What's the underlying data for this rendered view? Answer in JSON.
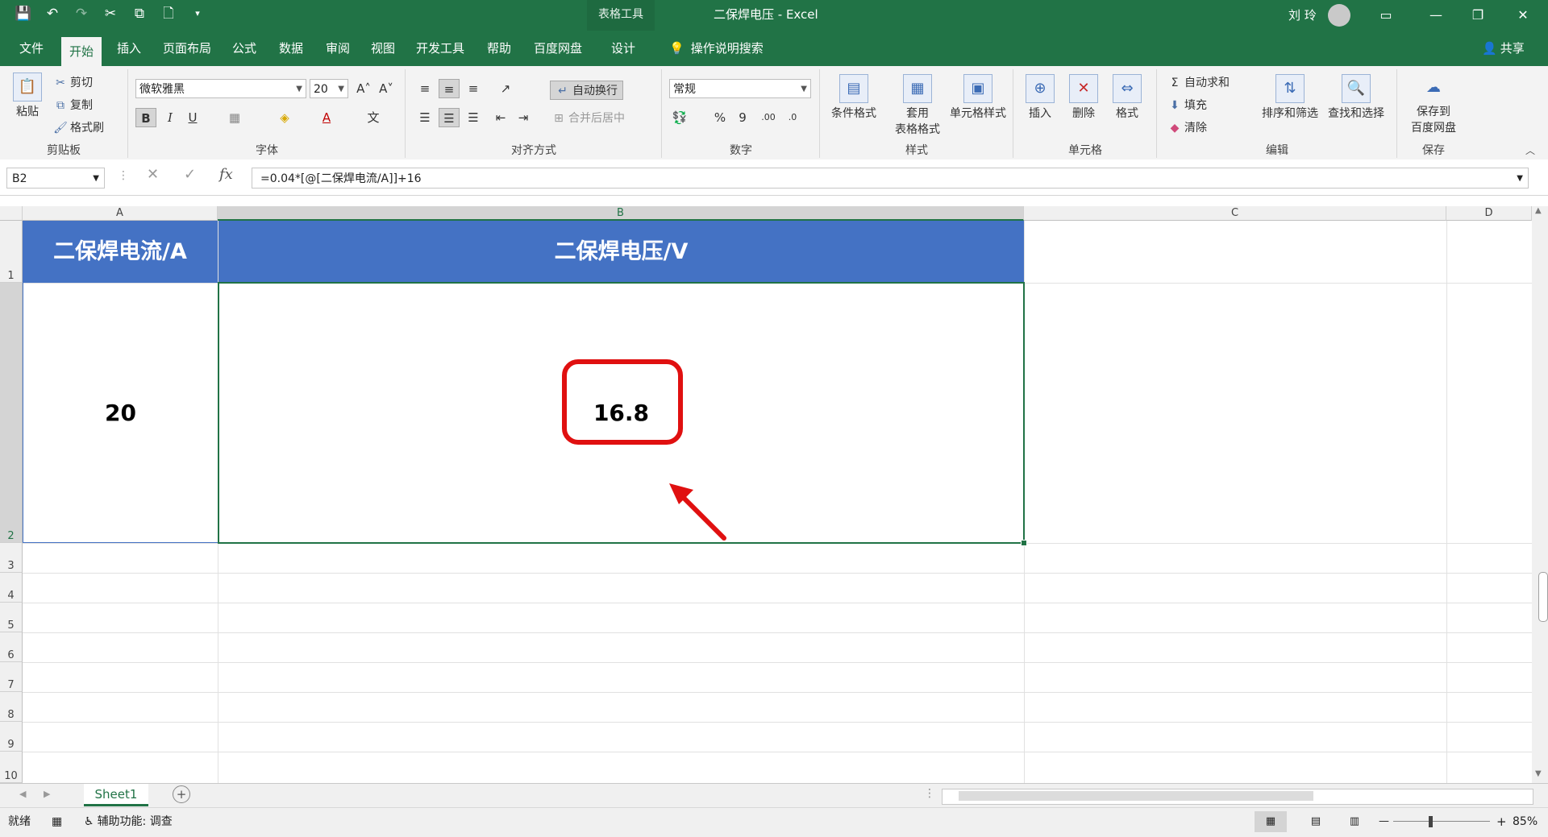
{
  "window": {
    "title": "二保焊电压  -  Excel",
    "context_tab": "表格工具",
    "user": "刘 玲",
    "controls": [
      "▭",
      "—",
      "❐",
      "✕"
    ]
  },
  "qat": [
    "💾",
    "↶",
    "↷",
    "✂",
    "⧉",
    "🗋",
    "▾"
  ],
  "tabs": [
    "文件",
    "开始",
    "插入",
    "页面布局",
    "公式",
    "数据",
    "审阅",
    "视图",
    "开发工具",
    "帮助",
    "百度网盘",
    "设计"
  ],
  "tell_me": "操作说明搜索",
  "share": "共享",
  "ribbon": {
    "clipboard": {
      "label": "剪贴板",
      "paste": "粘贴",
      "cut": "剪切",
      "copy": "复制",
      "format_painter": "格式刷"
    },
    "font": {
      "label": "字体",
      "name": "微软雅黑",
      "size": "20",
      "bold": "B",
      "italic": "I",
      "underline": "U",
      "grow": "A˄",
      "shrink": "A˅",
      "color_a": "A",
      "phonetic": "文"
    },
    "alignment": {
      "label": "对齐方式",
      "wrap": "自动换行",
      "merge": "合并后居中"
    },
    "number": {
      "label": "数字",
      "format": "常规",
      "percent": "%",
      "comma": "9",
      "inc": ".00",
      "dec": ".0"
    },
    "styles": {
      "label": "样式",
      "conditional": "条件格式",
      "table_format_1": "套用",
      "table_format_2": "表格格式",
      "cell_styles": "单元格样式"
    },
    "cells": {
      "label": "单元格",
      "insert": "插入",
      "delete": "删除",
      "format": "格式"
    },
    "editing": {
      "label": "编辑",
      "autosum": "自动求和",
      "fill": "填充",
      "clear": "清除",
      "sort": "排序和筛选",
      "find": "查找和选择"
    },
    "save": {
      "label": "保存",
      "save_to_1": "保存到",
      "save_to_2": "百度网盘"
    }
  },
  "formula_bar": {
    "name_box": "B2",
    "formula": "=0.04*[@[二保焊电流/A]]+16",
    "fx": "fx",
    "cancel": "✕",
    "enter": "✓"
  },
  "columns": [
    "A",
    "B",
    "C",
    "D"
  ],
  "rows": [
    "1",
    "2",
    "3",
    "4",
    "5",
    "6",
    "7",
    "8",
    "9",
    "10"
  ],
  "table": {
    "headers": [
      "二保焊电流/A",
      "二保焊电压/V"
    ],
    "row": [
      "20",
      "16.8"
    ]
  },
  "sheets": [
    "Sheet1"
  ],
  "add_sheet": "+",
  "status": {
    "ready": "就绪",
    "accessibility": "辅助功能: 调查",
    "zoom": "85%",
    "zoom_minus": "—",
    "zoom_plus": "+"
  },
  "annotation_color": "#e01010"
}
